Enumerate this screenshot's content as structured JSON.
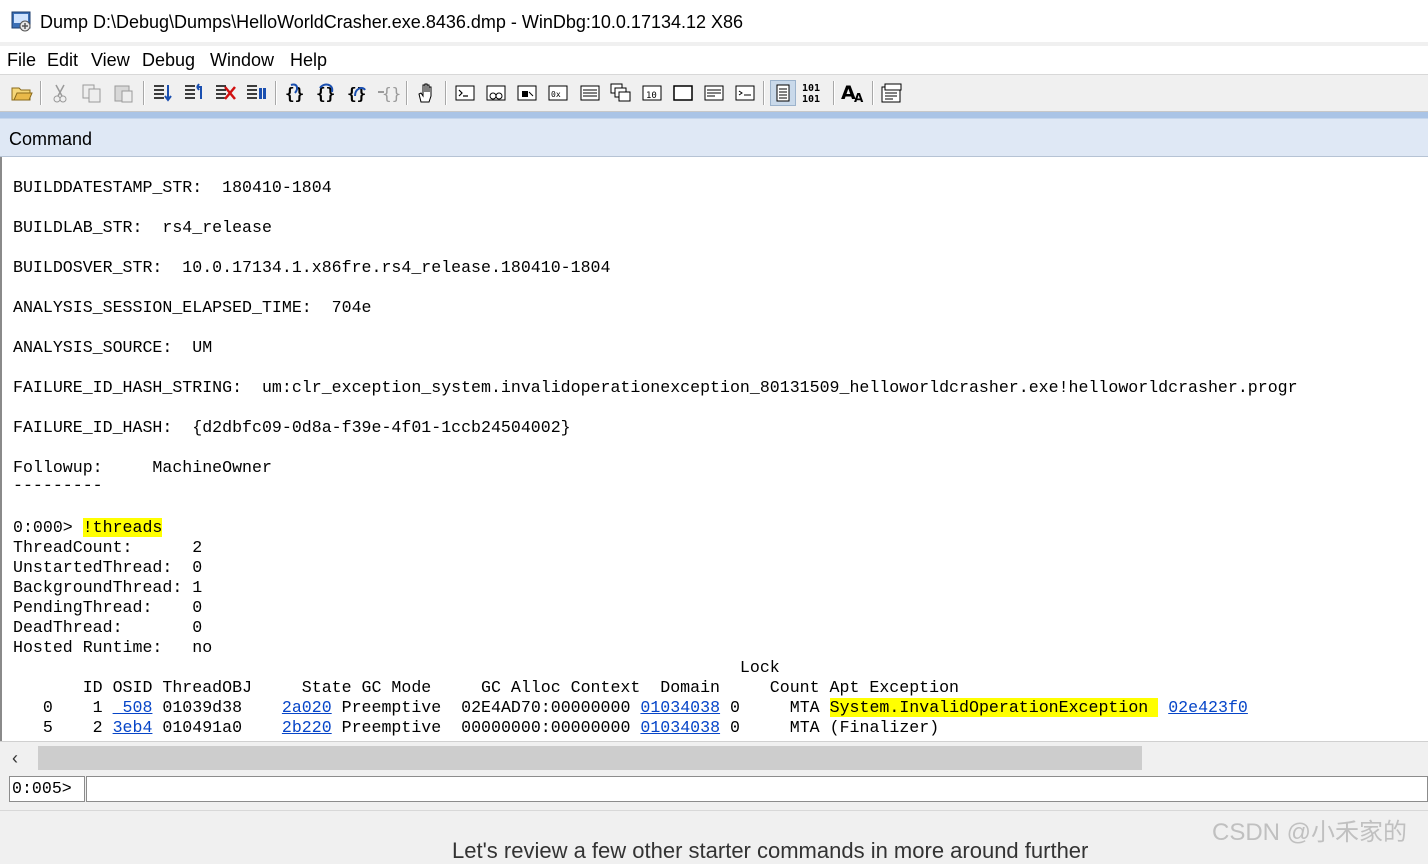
{
  "window": {
    "title": "Dump D:\\Debug\\Dumps\\HelloWorldCrasher.exe.8436.dmp - WinDbg:10.0.17134.12 X86",
    "icon": "windbg-app-icon"
  },
  "menu": [
    "File",
    "Edit",
    "View",
    "Debug",
    "Window",
    "Help"
  ],
  "toolbar": {
    "icons": [
      "open-icon",
      "cut-icon",
      "copy-icon",
      "paste-icon",
      "go-icon",
      "restart-icon",
      "stop-debugging-icon",
      "break-icon",
      "step-into-icon",
      "step-over-icon",
      "step-out-icon",
      "run-to-cursor-icon",
      "hand-source-mode-icon",
      "command-window-icon",
      "watch-window-icon",
      "locals-window-icon",
      "registers-window-icon",
      "memory-window-icon",
      "call-stack-icon",
      "disassembly-icon",
      "scratch-pad-icon",
      "processes-threads-icon",
      "options-icon",
      "source-mode-icon",
      "hex-binary-icon",
      "font-icon",
      "properties-icon"
    ],
    "hex_label": "101\n101",
    "font_label": "A"
  },
  "command_panel": {
    "title": "Command",
    "lines": [
      {
        "text": "BUILDDATESTAMP_STR:  180410-1804"
      },
      {
        "text": "BUILDLAB_STR:  rs4_release"
      },
      {
        "text": "BUILDOSVER_STR:  10.0.17134.1.x86fre.rs4_release.180410-1804"
      },
      {
        "text": "ANALYSIS_SESSION_ELAPSED_TIME:  704e"
      },
      {
        "text": "ANALYSIS_SOURCE:  UM"
      },
      {
        "text": "FAILURE_ID_HASH_STRING:  um:clr_exception_system.invalidoperationexception_80131509_helloworldcrasher.exe!helloworldcrasher.progr"
      },
      {
        "text": "FAILURE_ID_HASH:  {d2dbfc09-0d8a-f39e-4f01-1ccb24504002}"
      },
      {
        "text": "Followup:     MachineOwner"
      },
      {
        "text": "---------"
      }
    ],
    "prompt_line": {
      "prompt": "0:000> ",
      "command": "!threads"
    },
    "thread_summary": [
      "ThreadCount:      2",
      "UnstartedThread:  0",
      "BackgroundThread: 1",
      "PendingThread:    0",
      "DeadThread:       0",
      "Hosted Runtime:   no"
    ],
    "table_header_1": "                                                                         Lock",
    "table_header_2": "       ID OSID ThreadOBJ     State GC Mode     GC Alloc Context  Domain     Count Apt Exception",
    "rows": [
      {
        "idx": "   0    1 ",
        "osid": " 508",
        "threadobj": " 01039d38    ",
        "state": "2a020",
        "gcmode": " Preemptive  02E4AD70:00000000 ",
        "domain": "01034038",
        "count": " 0     MTA ",
        "exception": "System.InvalidOperationException",
        "exc_addr": "02e423f0"
      },
      {
        "idx": "   5    2 ",
        "osid": "3eb4",
        "threadobj": " 010491a0    ",
        "state": "2b220",
        "gcmode": " Preemptive  00000000:00000000 ",
        "domain": "01034038",
        "count": " 0     MTA ",
        "exception": "(Finalizer)",
        "exc_addr": ""
      }
    ]
  },
  "command_input": {
    "prompt": "0:005>",
    "value": ""
  },
  "overlay": {
    "watermark": "CSDN @小禾家的",
    "bottom_text": "Let's review a few other starter commands in more around further"
  }
}
